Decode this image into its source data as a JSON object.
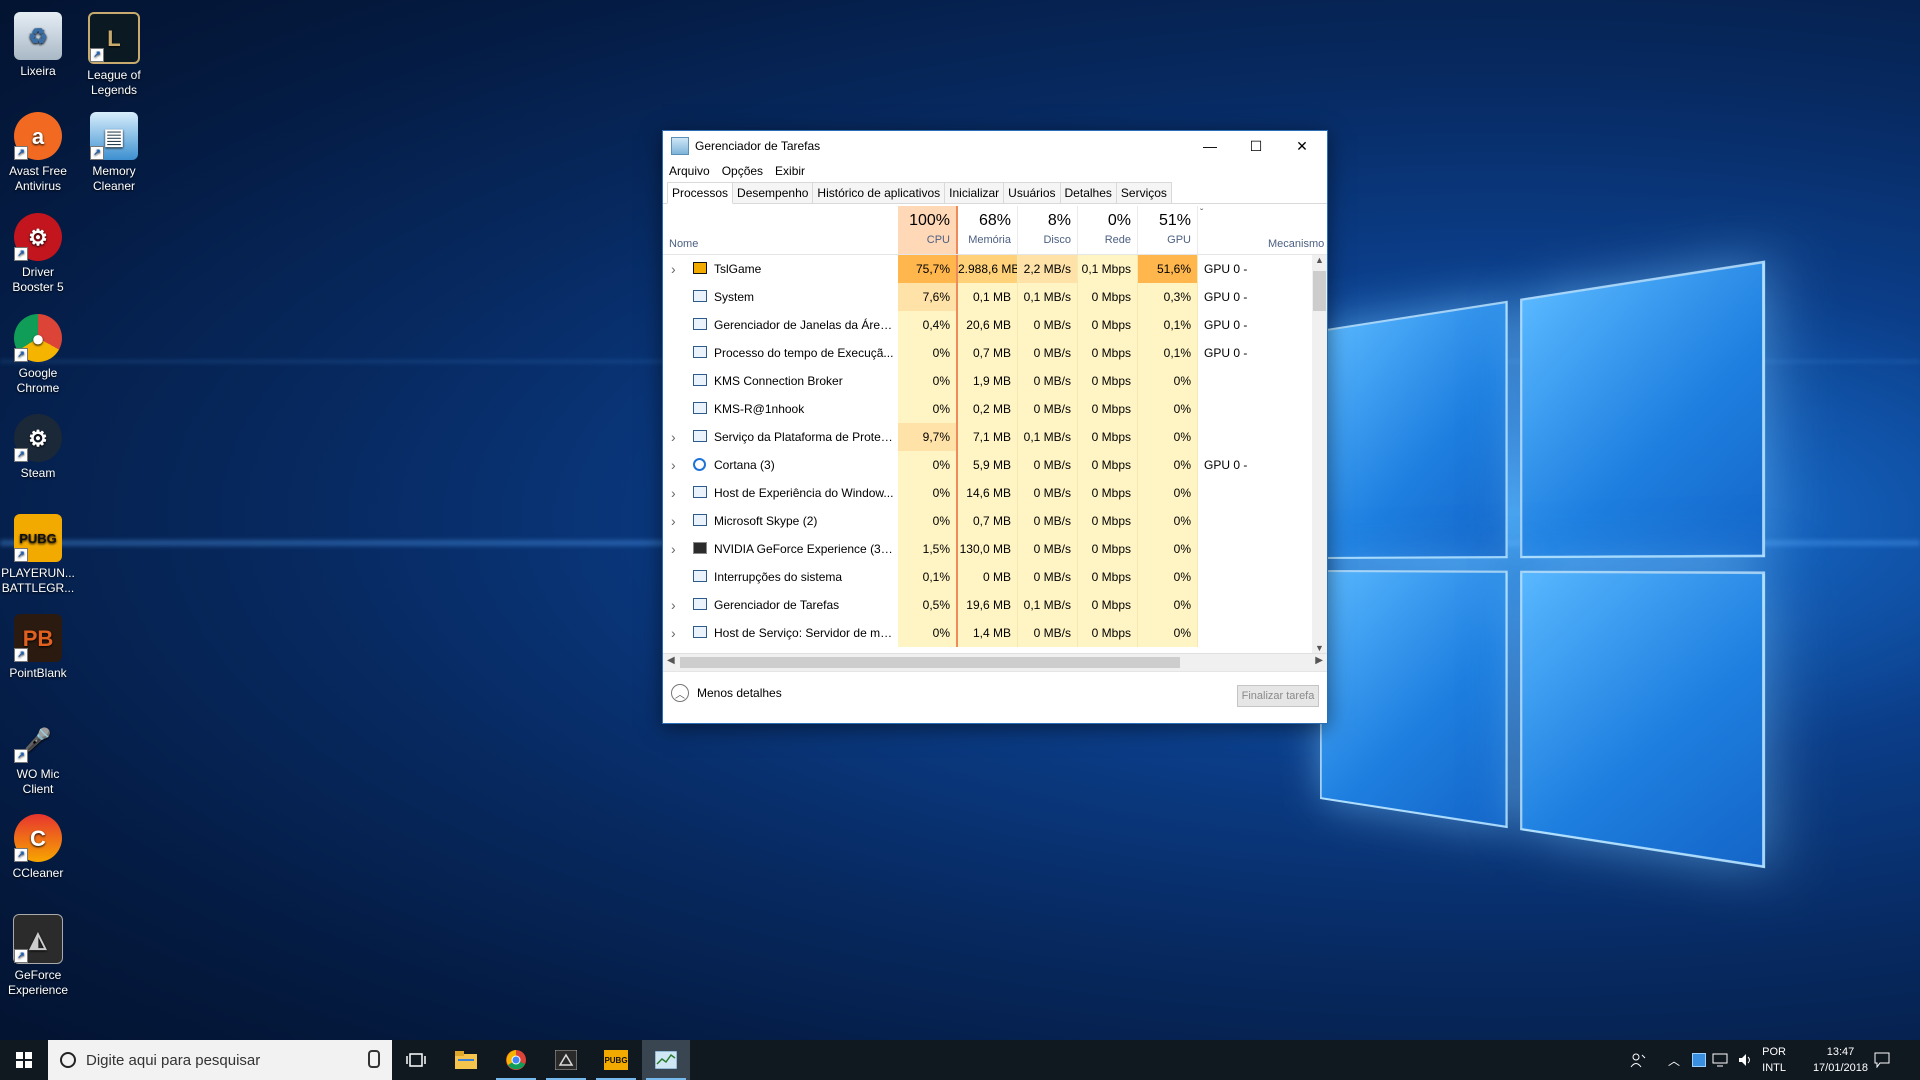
{
  "desktop": {
    "icons": [
      {
        "label": "Lixeira",
        "icon": "recycle-bin-icon"
      },
      {
        "label": "League of Legends",
        "icon": "league-of-legends-icon"
      },
      {
        "label": "Avast Free Antivirus",
        "icon": "avast-icon"
      },
      {
        "label": "Memory Cleaner",
        "icon": "memory-cleaner-icon"
      },
      {
        "label": "Driver Booster 5",
        "icon": "driver-booster-icon"
      },
      {
        "label": "Google Chrome",
        "icon": "chrome-icon"
      },
      {
        "label": "Steam",
        "icon": "steam-icon"
      },
      {
        "label": "PLAYERUN... BATTLEGR...",
        "icon": "pubg-icon"
      },
      {
        "label": "PointBlank",
        "icon": "pointblank-icon"
      },
      {
        "label": "WO Mic Client",
        "icon": "microphone-icon"
      },
      {
        "label": "CCleaner",
        "icon": "ccleaner-icon"
      },
      {
        "label": "GeForce Experience",
        "icon": "geforce-icon"
      }
    ]
  },
  "taskmanager": {
    "title": "Gerenciador de Tarefas",
    "menu": [
      "Arquivo",
      "Opções",
      "Exibir"
    ],
    "tabs": [
      "Processos",
      "Desempenho",
      "Histórico de aplicativos",
      "Inicializar",
      "Usuários",
      "Detalhes",
      "Serviços"
    ],
    "active_tab": "Processos",
    "columns": {
      "name": "Nome",
      "cpu": {
        "pct": "100%",
        "label": "CPU"
      },
      "mem": {
        "pct": "68%",
        "label": "Memória"
      },
      "disk": {
        "pct": "8%",
        "label": "Disco"
      },
      "net": {
        "pct": "0%",
        "label": "Rede"
      },
      "gpu": {
        "pct": "51%",
        "label": "GPU"
      },
      "engine": "Mecanismo"
    },
    "rows": [
      {
        "expand": true,
        "name": "TslGame",
        "cpu": "75,7%",
        "mem": "2.988,6 MB",
        "disk": "2,2 MB/s",
        "net": "0,1 Mbps",
        "gpu": "51,6%",
        "engine": "GPU 0 -",
        "icon": "pubg-icon"
      },
      {
        "expand": false,
        "name": "System",
        "cpu": "7,6%",
        "mem": "0,1 MB",
        "disk": "0,1 MB/s",
        "net": "0 Mbps",
        "gpu": "0,3%",
        "engine": "GPU 0 -",
        "icon": "window-icon"
      },
      {
        "expand": false,
        "name": "Gerenciador de Janelas da Área ...",
        "cpu": "0,4%",
        "mem": "20,6 MB",
        "disk": "0 MB/s",
        "net": "0 Mbps",
        "gpu": "0,1%",
        "engine": "GPU 0 -",
        "icon": "window-icon"
      },
      {
        "expand": false,
        "name": "Processo do tempo de Execuçã...",
        "cpu": "0%",
        "mem": "0,7 MB",
        "disk": "0 MB/s",
        "net": "0 Mbps",
        "gpu": "0,1%",
        "engine": "GPU 0 -",
        "icon": "window-icon"
      },
      {
        "expand": false,
        "name": "KMS Connection Broker",
        "cpu": "0%",
        "mem": "1,9 MB",
        "disk": "0 MB/s",
        "net": "0 Mbps",
        "gpu": "0%",
        "engine": "",
        "icon": "window-icon"
      },
      {
        "expand": false,
        "name": "KMS-R@1nhook",
        "cpu": "0%",
        "mem": "0,2 MB",
        "disk": "0 MB/s",
        "net": "0 Mbps",
        "gpu": "0%",
        "engine": "",
        "icon": "window-icon"
      },
      {
        "expand": true,
        "name": "Serviço da Plataforma de Proteç...",
        "cpu": "9,7%",
        "mem": "7,1 MB",
        "disk": "0,1 MB/s",
        "net": "0 Mbps",
        "gpu": "0%",
        "engine": "",
        "icon": "window-icon"
      },
      {
        "expand": true,
        "name": "Cortana (3)",
        "cpu": "0%",
        "mem": "5,9 MB",
        "disk": "0 MB/s",
        "net": "0 Mbps",
        "gpu": "0%",
        "engine": "GPU 0 -",
        "icon": "cortana-icon"
      },
      {
        "expand": true,
        "name": "Host de Experiência do Window...",
        "cpu": "0%",
        "mem": "14,6 MB",
        "disk": "0 MB/s",
        "net": "0 Mbps",
        "gpu": "0%",
        "engine": "",
        "icon": "window-icon"
      },
      {
        "expand": true,
        "name": "Microsoft Skype (2)",
        "cpu": "0%",
        "mem": "0,7 MB",
        "disk": "0 MB/s",
        "net": "0 Mbps",
        "gpu": "0%",
        "engine": "",
        "icon": "window-icon"
      },
      {
        "expand": true,
        "name": "NVIDIA GeForce Experience (32 ...",
        "cpu": "1,5%",
        "mem": "130,0 MB",
        "disk": "0 MB/s",
        "net": "0 Mbps",
        "gpu": "0%",
        "engine": "",
        "icon": "geforce-icon"
      },
      {
        "expand": false,
        "name": "Interrupções do sistema",
        "cpu": "0,1%",
        "mem": "0 MB",
        "disk": "0 MB/s",
        "net": "0 Mbps",
        "gpu": "0%",
        "engine": "",
        "icon": "window-icon"
      },
      {
        "expand": true,
        "name": "Gerenciador de Tarefas",
        "cpu": "0,5%",
        "mem": "19,6 MB",
        "disk": "0,1 MB/s",
        "net": "0 Mbps",
        "gpu": "0%",
        "engine": "",
        "icon": "taskmanager-icon"
      },
      {
        "expand": true,
        "name": "Host de Serviço: Servidor de mo...",
        "cpu": "0%",
        "mem": "1,4 MB",
        "disk": "0 MB/s",
        "net": "0 Mbps",
        "gpu": "0%",
        "engine": "",
        "icon": "gear-icon"
      }
    ],
    "fewer_details": "Menos detalhes",
    "end_task": "Finalizar tarefa"
  },
  "taskbar": {
    "search_placeholder": "Digite aqui para pesquisar",
    "lang_top": "POR",
    "lang_bottom": "INTL",
    "time": "13:47",
    "date": "17/01/2018"
  }
}
